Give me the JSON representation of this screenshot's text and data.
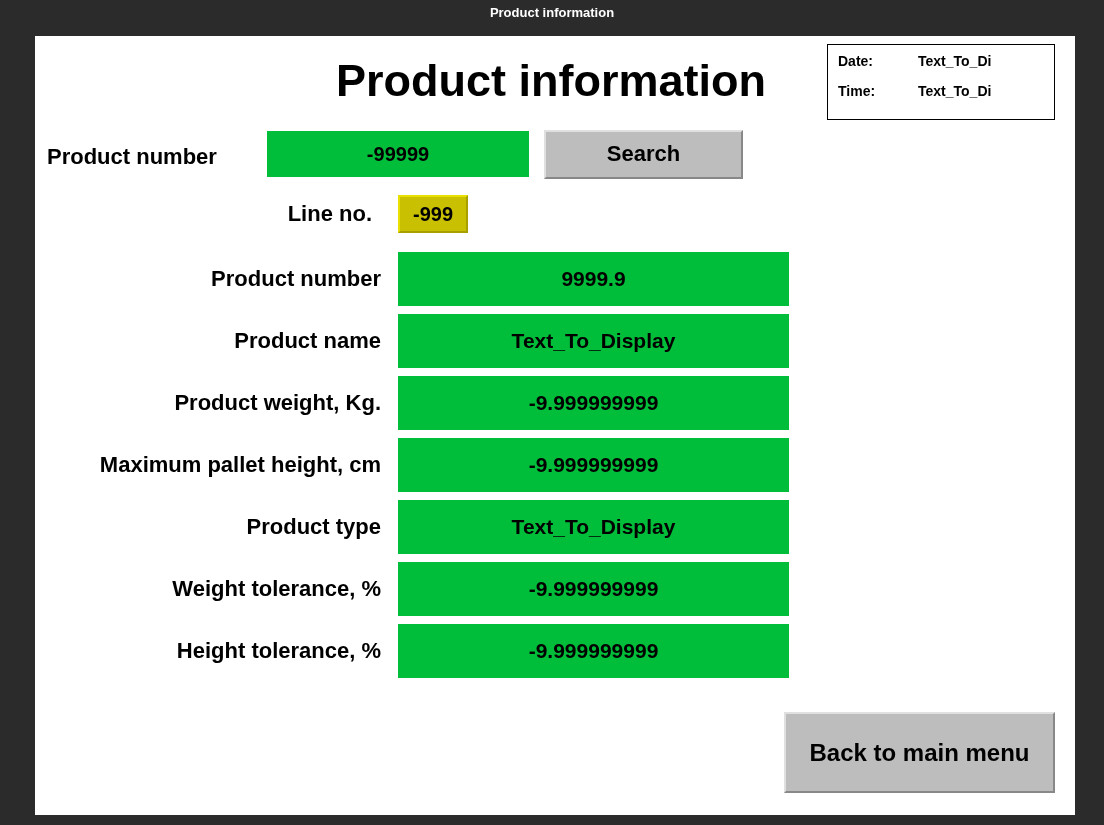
{
  "window": {
    "title": "Product information"
  },
  "heading": "Product information",
  "clock": [
    {
      "label": "Date:",
      "value": "Text_To_Di"
    },
    {
      "label": "Time:",
      "value": "Text_To_Di"
    }
  ],
  "search": {
    "label": "Product number",
    "value": "-99999",
    "button": "Search"
  },
  "line_no": {
    "label": "Line no.",
    "value": "-999"
  },
  "details": [
    {
      "label": "Product number",
      "value": "9999.9"
    },
    {
      "label": "Product name",
      "value": "Text_To_Display"
    },
    {
      "label": "Product weight, Kg.",
      "value": "-9.999999999"
    },
    {
      "label": "Maximum pallet height, cm",
      "value": "-9.999999999"
    },
    {
      "label": "Product type",
      "value": "Text_To_Display"
    },
    {
      "label": "Weight tolerance, %",
      "value": "-9.999999999"
    },
    {
      "label": "Height tolerance, %",
      "value": "-9.999999999"
    }
  ],
  "back_button": "Back to main menu"
}
